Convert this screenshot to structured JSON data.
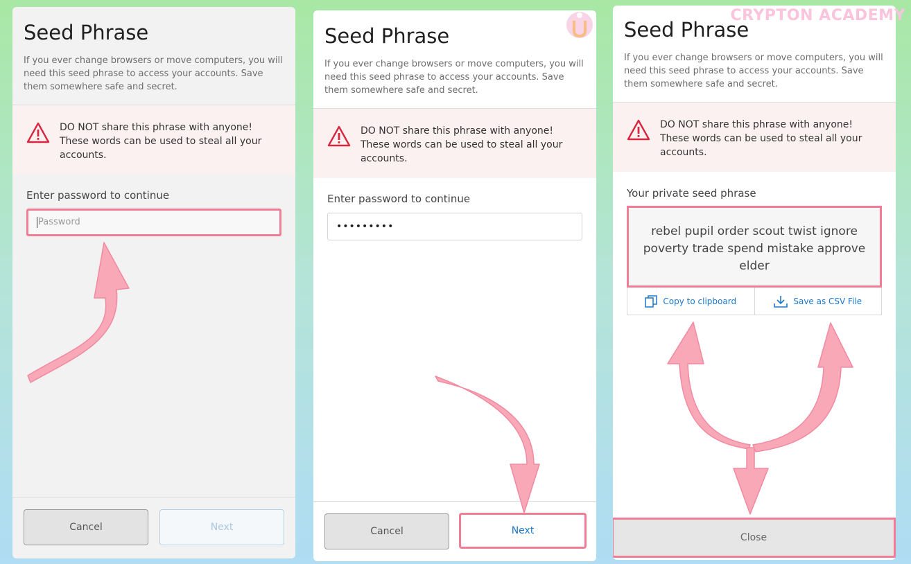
{
  "watermark": {
    "brand": "CRYPTON ACADEMY"
  },
  "colors": {
    "highlight": "#f27c94",
    "link": "#1d78c8",
    "warning": "#d7263d"
  },
  "panel1": {
    "title": "Seed Phrase",
    "description": "If you ever change browsers or move computers, you will need this seed phrase to access your accounts. Save them somewhere safe and secret.",
    "warning": "DO NOT share this phrase with anyone! These words can be used to steal all your accounts.",
    "password_label": "Enter password to continue",
    "password_placeholder": "Password",
    "cancel_label": "Cancel",
    "next_label": "Next"
  },
  "panel2": {
    "title": "Seed Phrase",
    "description": "If you ever change browsers or move computers, you will need this seed phrase to access your accounts. Save them somewhere safe and secret.",
    "warning": "DO NOT share this phrase with anyone! These words can be used to steal all your accounts.",
    "password_label": "Enter password to continue",
    "password_value": "•••••••••",
    "cancel_label": "Cancel",
    "next_label": "Next"
  },
  "panel3": {
    "title": "Seed Phrase",
    "description": "If you ever change browsers or move computers, you will need this seed phrase to access your accounts. Save them somewhere safe and secret.",
    "warning": "DO NOT share this phrase with anyone! These words can be used to steal all your accounts.",
    "seed_label": "Your private seed phrase",
    "seed_phrase": "rebel pupil order scout twist ignore poverty trade spend mistake approve elder",
    "copy_label": "Copy to clipboard",
    "csv_label": "Save as CSV File",
    "close_label": "Close"
  }
}
